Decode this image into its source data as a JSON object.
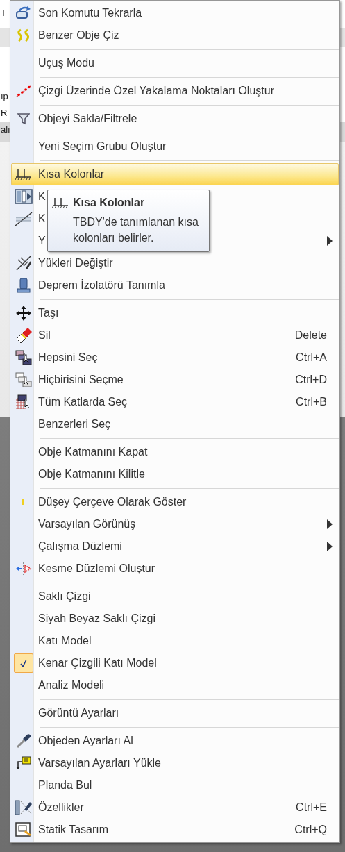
{
  "background": {
    "texts": [
      "T",
      "ıp",
      "R",
      "alı"
    ]
  },
  "menu": {
    "groups": [
      [
        {
          "label": "Son Komutu Tekrarla",
          "selected": false
        },
        {
          "label": "Benzer Obje Çiz",
          "selected": false
        }
      ],
      [
        {
          "label": "Uçuş Modu",
          "selected": false
        }
      ],
      [
        {
          "label": "Çizgi Üzerinde Özel Yakalama Noktaları Oluştur",
          "selected": false
        }
      ],
      [
        {
          "label": "Objeyi Sakla/Filtrele",
          "selected": false
        }
      ],
      [
        {
          "label": "Yeni Seçim Grubu Oluştur",
          "selected": false
        }
      ],
      [
        {
          "label": "Kısa Kolonlar",
          "selected": true
        },
        {
          "label": "K",
          "selected": false
        },
        {
          "label": "K",
          "selected": false
        },
        {
          "label": "Y",
          "selected": false,
          "submenu": true
        },
        {
          "label": "Yükleri Değiştir",
          "selected": false
        },
        {
          "label": "Deprem İzolatörü Tanımla",
          "selected": false
        }
      ],
      [
        {
          "label": "Taşı",
          "selected": false
        },
        {
          "label": "Sil",
          "shortcut": "Delete",
          "selected": false
        },
        {
          "label": "Hepsini Seç",
          "shortcut": "Ctrl+A",
          "selected": false
        },
        {
          "label": "Hiçbirisini Seçme",
          "shortcut": "Ctrl+D",
          "selected": false
        },
        {
          "label": "Tüm Katlarda Seç",
          "shortcut": "Ctrl+B",
          "selected": false
        },
        {
          "label": "Benzerleri Seç",
          "selected": false
        }
      ],
      [
        {
          "label": "Obje Katmanını Kapat",
          "selected": false
        },
        {
          "label": "Obje Katmanını Kilitle",
          "selected": false
        }
      ],
      [
        {
          "label": "Düşey Çerçeve Olarak Göster",
          "selected": false
        },
        {
          "label": "Varsayılan Görünüş",
          "selected": false,
          "submenu": true
        },
        {
          "label": "Çalışma Düzlemi",
          "selected": false,
          "submenu": true
        },
        {
          "label": "Kesme Düzlemi Oluştur",
          "selected": false
        }
      ],
      [
        {
          "label": "Saklı Çizgi",
          "selected": false,
          "checked": false
        },
        {
          "label": "Siyah Beyaz Saklı Çizgi",
          "selected": false,
          "checked": false
        },
        {
          "label": "Katı Model",
          "selected": false,
          "checked": false
        },
        {
          "label": "Kenar Çizgili Katı Model",
          "selected": false,
          "checked": true
        },
        {
          "label": "Analiz Modeli",
          "selected": false,
          "checked": false
        }
      ],
      [
        {
          "label": "Görüntü Ayarları",
          "selected": false
        }
      ],
      [
        {
          "label": "Objeden Ayarları Al",
          "selected": false
        },
        {
          "label": "Varsayılan Ayarları Yükle",
          "selected": false
        },
        {
          "label": "Planda Bul",
          "selected": false
        },
        {
          "label": "Özellikler",
          "shortcut": "Ctrl+E",
          "selected": false
        },
        {
          "label": "Statik Tasarım",
          "shortcut": "Ctrl+Q",
          "selected": false
        }
      ]
    ]
  },
  "tooltip": {
    "title": "Kısa Kolonlar",
    "text": "TBDY'de tanımlanan kısa kolonları belirler."
  }
}
